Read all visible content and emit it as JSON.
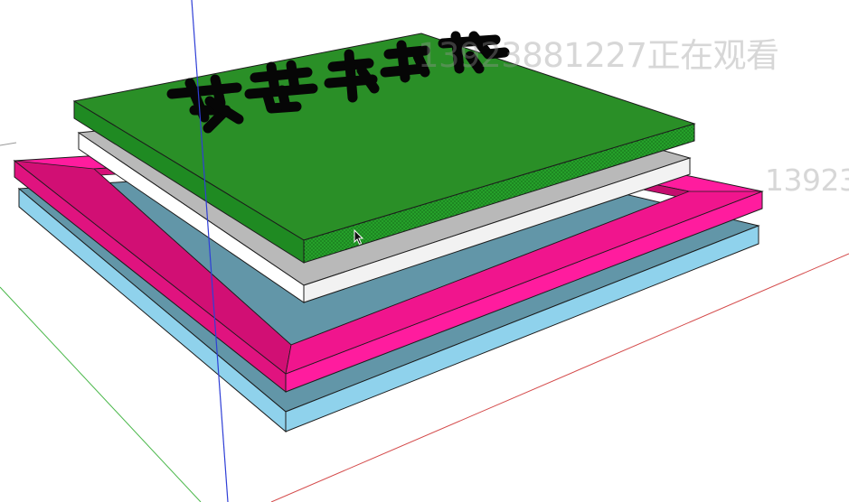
{
  "app": {
    "name": "3D modeling viewport"
  },
  "colors": {
    "background": "#ffffff",
    "green_top": "#2a8f27",
    "green_side": "#1f7a1c",
    "green_dotted": "#25a02a",
    "gray_top": "#b9b9b9",
    "gray_side": "#ffffff",
    "pink_top": "#ff1c9e",
    "pink_side": "#e0137f",
    "pink_inner": "#d60f78",
    "blue_top": "#6296a8",
    "blue_side": "#8fd2ec",
    "edge": "#1c1c1c",
    "text_3d": "#060606",
    "axis_blue": "#2f3fd6",
    "axis_red": "#d44a4a",
    "axis_green": "#4bb84b",
    "watermark": "#9a9a9a"
  },
  "icons": {
    "cursor": "arrow-cursor-icon"
  },
  "watermarks": {
    "primary": "13923881227正在观看",
    "secondary": "13923"
  },
  "model": {
    "layers": [
      "green top plate with 3D text",
      "gray sheet",
      "pink frame",
      "blue base plate"
    ]
  }
}
